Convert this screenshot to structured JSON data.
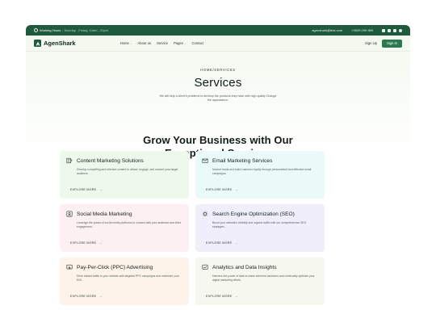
{
  "topbar": {
    "hours_label": "Working Hours",
    "hours_value": ": Monday - Friday, 10am - 20pm",
    "email": "agenshark@test.com",
    "phone": "+3929 299 989",
    "social_icons": [
      "facebook-icon",
      "email-icon",
      "linkedin-icon",
      "pinterest-icon"
    ]
  },
  "nav": {
    "logo": "AgenShark",
    "items": [
      {
        "label": "Home",
        "dropdown": true
      },
      {
        "label": "About us",
        "dropdown": false
      },
      {
        "label": "Service",
        "dropdown": false
      },
      {
        "label": "Pages",
        "dropdown": true
      },
      {
        "label": "Contact",
        "dropdown": false
      }
    ],
    "signup": "Sign Up",
    "signin": "Sign In"
  },
  "hero": {
    "breadcrumb": "HOME/SERVICES",
    "title": "Services",
    "description": "We will help a client's problems to develop the products they have with high quality Change the appearance."
  },
  "section": {
    "title_line1": "Grow Your Business with Our",
    "title_line2": "Exceptional Services"
  },
  "services": [
    {
      "title": "Content Marketing Solutions",
      "description": "Develop compelling and relevant content to attract, engage, and convert your target audience.",
      "link": "EXPLORE MORE",
      "icon": "content-marketing-icon",
      "bg": "#eef8ec"
    },
    {
      "title": "Email Marketing Services",
      "description": "Nurture leads and build customer loyalty through personalized and effective email campaigns.",
      "link": "EXPLORE MORE",
      "icon": "email-marketing-icon",
      "bg": "#eafaf9"
    },
    {
      "title": "Social Media Marketing",
      "description": "Leverage the power of social media platforms to connect with your audience and drive engagement.",
      "link": "EXPLORE MORE",
      "icon": "social-media-icon",
      "bg": "#fdf0f3"
    },
    {
      "title": "Search Engine Optimization (SEO)",
      "description": "Boost your website's visibility and organic traffic with our comprehensive SEO strategies.",
      "link": "EXPLORE MORE",
      "icon": "seo-icon",
      "bg": "#f1eefc"
    },
    {
      "title": "Pay-Per-Click (PPC) Advertising",
      "description": "Drive instant traffic to your website with targeted PPC campaigns and maximize your ROI.",
      "link": "EXPLORE MORE",
      "icon": "ppc-icon",
      "bg": "#fdf3ea"
    },
    {
      "title": "Analytics and Data Insights",
      "description": "Harness the power of data to make informed decisions and continually optimize your digital marketing efforts.",
      "link": "EXPLORE MORE",
      "icon": "analytics-icon",
      "bg": "#f6f7ef"
    }
  ],
  "colors": {
    "brand_dark": "#1f5a3c",
    "brand_button": "#2a7a50",
    "accent_arrow": "#3d8a5e"
  }
}
